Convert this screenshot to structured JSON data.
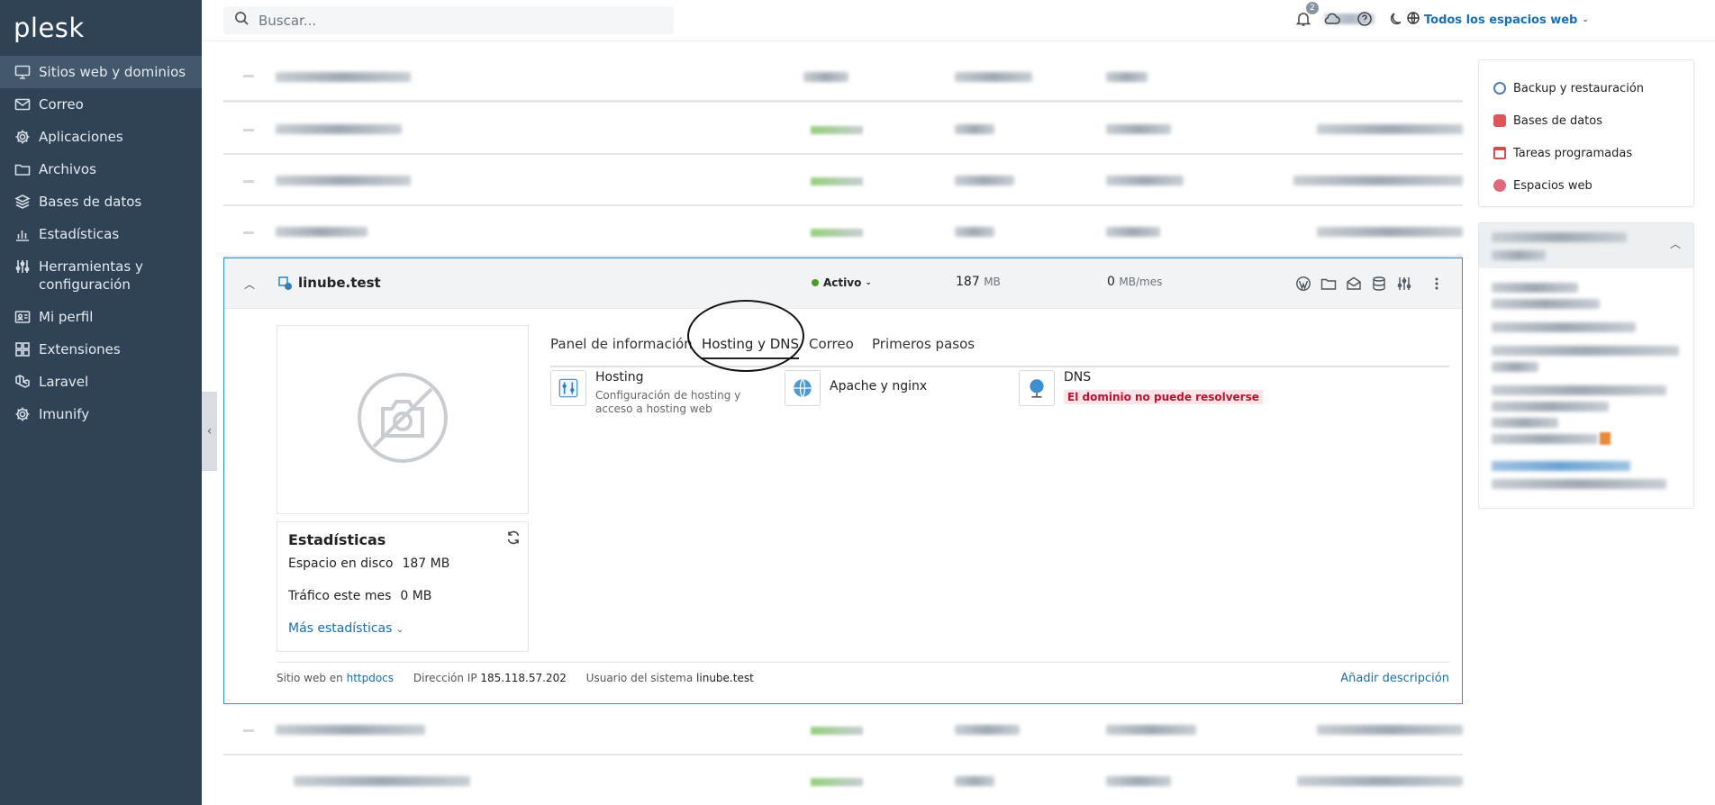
{
  "app": {
    "logo": "plesk"
  },
  "sidebar": {
    "items": [
      {
        "label": "Sitios web y dominios",
        "icon": "monitor-icon",
        "active": true
      },
      {
        "label": "Correo",
        "icon": "mail-icon"
      },
      {
        "label": "Aplicaciones",
        "icon": "gear-icon"
      },
      {
        "label": "Archivos",
        "icon": "folder-icon"
      },
      {
        "label": "Bases de datos",
        "icon": "layers-icon"
      },
      {
        "label": "Estadísticas",
        "icon": "bar-chart-icon"
      },
      {
        "label": "Herramientas y configuración",
        "icon": "sliders-icon"
      },
      {
        "label": "Mi perfil",
        "icon": "user-card-icon"
      },
      {
        "label": "Extensiones",
        "icon": "extensions-icon"
      },
      {
        "label": "Laravel",
        "icon": "laravel-icon"
      },
      {
        "label": "Imunify",
        "icon": "gear-icon"
      }
    ]
  },
  "topbar": {
    "search_placeholder": "Buscar...",
    "workspace_label": "Todos los espacios web",
    "notifications_count": "2"
  },
  "expanded_site": {
    "name": "linube.test",
    "status": "Activo",
    "disk_value": "187",
    "disk_unit": "MB",
    "traffic_value": "0",
    "traffic_unit": "MB/mes",
    "tabs": [
      "Panel de información",
      "Hosting y DNS",
      "Correo",
      "Primeros pasos"
    ],
    "active_tab": "Hosting y DNS",
    "tools": {
      "hosting": {
        "name": "Hosting",
        "desc": "Configuración de hosting y acceso a hosting web"
      },
      "apache": {
        "name": "Apache y nginx"
      },
      "dns": {
        "name": "DNS",
        "error": "El dominio no puede resolverse"
      }
    },
    "stats": {
      "title": "Estadísticas",
      "disk_label": "Espacio en disco",
      "disk_value": "187 MB",
      "traffic_label": "Tráfico este mes",
      "traffic_value": "0 MB",
      "more_label": "Más estadísticas"
    },
    "footer": {
      "site_label": "Sitio web en",
      "site_link": "httpdocs",
      "ip_label": "Dirección IP",
      "ip_value": "185.118.57.202",
      "sysuser_label": "Usuario del sistema",
      "sysuser_value": "linube.test",
      "add_description": "Añadir descripción"
    }
  },
  "right_panel": {
    "links": [
      {
        "label": "Backup y restauración",
        "icon": "backup-icon",
        "color": "#4a7fb5"
      },
      {
        "label": "Bases de datos",
        "icon": "database-icon",
        "color": "#e0555a"
      },
      {
        "label": "Tareas programadas",
        "icon": "calendar-icon",
        "color": "#d94b4b"
      },
      {
        "label": "Espacios web",
        "icon": "webspace-icon",
        "color": "#e06a7a"
      }
    ]
  },
  "colors": {
    "sidebar_bg": "#2f4256",
    "accent": "#1a6fb0",
    "active_status": "#4c9a2a",
    "error": "#c0102d"
  }
}
